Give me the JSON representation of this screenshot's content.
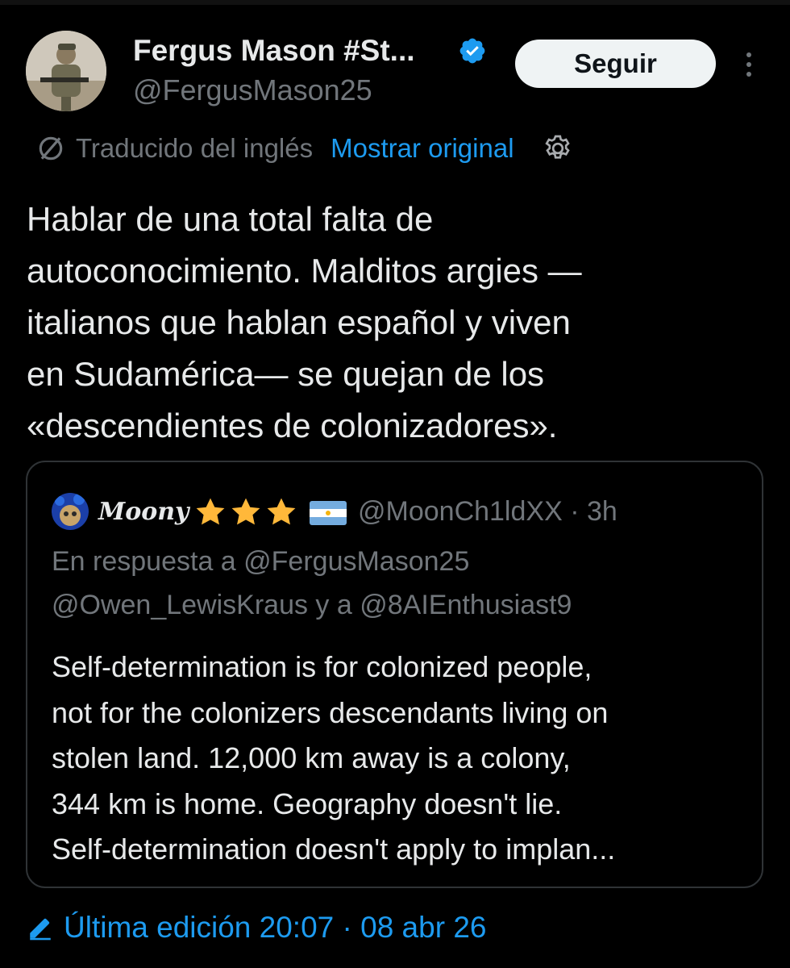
{
  "colors": {
    "background": "#000000",
    "text_primary": "#e7e9ea",
    "text_secondary": "#71767b",
    "accent": "#1d9bf0",
    "border": "#2f3336",
    "button_bg": "#eff3f4"
  },
  "header": {
    "display_name": "Fergus Mason #St...",
    "handle": "@FergusMason25",
    "follow_label": "Seguir",
    "verified_icon": "verified-badge-icon",
    "more_icon": "more-vertical-icon"
  },
  "translation": {
    "label": "Traducido del inglés",
    "show_original": "Mostrar original",
    "settings_icon": "gear-icon",
    "translate_icon": "no-symbol-icon"
  },
  "tweet": {
    "text": "Hablar de una total falta de\nautoconocimiento. Malditos argies —\nitalianos que hablan español y viven\nen Sudamérica— se quejan de los\n«descendientes de colonizadores»."
  },
  "quote": {
    "name": "Moony",
    "stars_icon": "star-icon",
    "flag_icon": "argentina-flag-icon",
    "handle_time": "@MoonCh1ldXX · 3h",
    "reply_lines": [
      "En respuesta a @FergusMason25",
      "@Owen_LewisKraus y a @8AIEnthusiast9"
    ],
    "text_lines": [
      "Self-determination is for colonized people,",
      "not for the colonizers descendants living on",
      "stolen land. 12,000 km away is a colony,",
      "344 km is home. Geography doesn't lie.",
      "Self-determination doesn't apply to implan..."
    ]
  },
  "edited": {
    "label": "Última edición 20:07 · 08 abr 26",
    "icon": "pencil-icon"
  }
}
